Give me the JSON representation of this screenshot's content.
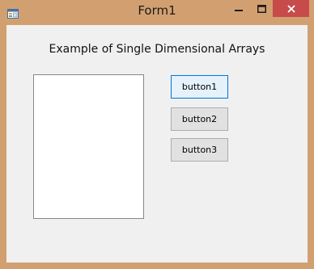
{
  "window": {
    "title": "Form1",
    "frame_color": "#d2a070",
    "close_color": "#c74b4b"
  },
  "icons": {
    "app": "form-app-icon",
    "minimize": "minimize-icon",
    "maximize": "maximize-icon",
    "close": "close-icon"
  },
  "form": {
    "heading": "Example of Single Dimensional Arrays",
    "buttons": [
      {
        "label": "button1",
        "focused": true
      },
      {
        "label": "button2",
        "focused": false
      },
      {
        "label": "button3",
        "focused": false
      }
    ],
    "listbox_items": []
  }
}
